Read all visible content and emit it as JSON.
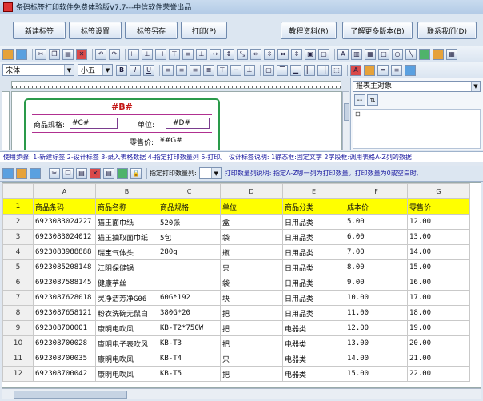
{
  "window": {
    "title": "条码标签打印软件免费体验版V7.7---中信软件荣誉出品"
  },
  "buttons": {
    "new_label": "新建标签",
    "label_settings": "标签设置",
    "save_as": "标签另存",
    "print": "打印(P)",
    "tutorial": "教程资料(R)",
    "more_versions": "了解更多版本(B)",
    "contact": "联系我们(D)"
  },
  "format": {
    "font": "宋体",
    "size": "小五"
  },
  "label_preview": {
    "title_field": "#B#",
    "spec_label": "商品规格:",
    "spec_value": "#C#",
    "unit_label": "单位:",
    "unit_value": "#D#",
    "price_label": "零售价:",
    "price_value": "¥#G#"
  },
  "properties": {
    "object_selector": "报表主对象"
  },
  "steps_text": "使用步骤: 1-新建标签 2-设计标签 3-录入表格数据 4-指定打印数量列 5-打印。  设计标签说明: 1静态框:固定文字 2字段框:调用表格A-Z列的数据",
  "data_toolbar": {
    "print_qty_label": "指定打印数量列:",
    "note": "打印数量列说明: 指定A-Z哪一列为打印数量。打印数量为0或空白时,"
  },
  "sheet": {
    "columns": [
      "A",
      "B",
      "C",
      "D",
      "E",
      "F",
      "G"
    ],
    "rows": [
      [
        "1",
        "商品条码",
        "商品名称",
        "商品规格",
        "单位",
        "商品分类",
        "成本价",
        "零售价"
      ],
      [
        "2",
        "6923083024227",
        "猫王面巾纸",
        "520张",
        "盒",
        "日用品类",
        "5.00",
        "12.00"
      ],
      [
        "3",
        "6923083024012",
        "猫王抽取面巾纸",
        "5包",
        "袋",
        "日用品类",
        "6.00",
        "13.00"
      ],
      [
        "4",
        "6923083988888",
        "瑞宝气体头",
        "280g",
        "瓶",
        "日用品类",
        "7.00",
        "14.00"
      ],
      [
        "5",
        "6923085208148",
        "江阴保健锅",
        "",
        "只",
        "日用品类",
        "8.00",
        "15.00"
      ],
      [
        "6",
        "6923087588145",
        "健康芋丝",
        "",
        "袋",
        "日用品类",
        "9.00",
        "16.00"
      ],
      [
        "7",
        "6923087628018",
        "灵净洁芳净G06",
        "60G*192",
        "块",
        "日用品类",
        "10.00",
        "17.00"
      ],
      [
        "8",
        "6923087658121",
        "粉衣洗碗无鼠白",
        "380G*20",
        "把",
        "日用品类",
        "11.00",
        "18.00"
      ],
      [
        "9",
        "692308700001",
        "康明电吹风",
        "KB-T2*750W",
        "把",
        "电器类",
        "12.00",
        "19.00"
      ],
      [
        "10",
        "692308700028",
        "康明电子表吹风",
        "KB-T3",
        "把",
        "电器类",
        "13.00",
        "20.00"
      ],
      [
        "11",
        "692308700035",
        "康明电吹风",
        "KB-T4",
        "只",
        "电器类",
        "14.00",
        "21.00"
      ],
      [
        "12",
        "692308700042",
        "康明电吹风",
        "KB-T5",
        "把",
        "电器类",
        "15.00",
        "22.00"
      ]
    ]
  }
}
